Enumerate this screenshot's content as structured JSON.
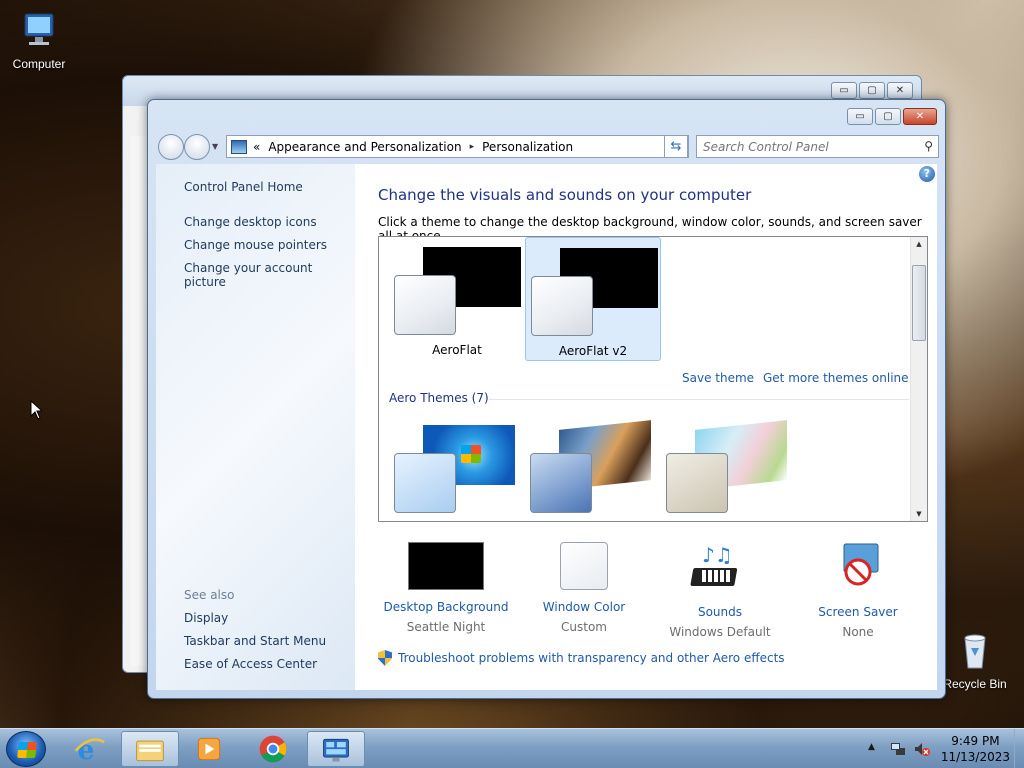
{
  "desktop": {
    "computer_label": "Computer",
    "recycle_label": "Recycle Bin"
  },
  "window": {
    "controls": {
      "minimize": "▭",
      "maximize": "▢",
      "close": "✕"
    },
    "address": {
      "crumbs": [
        "Appearance and Personalization",
        "Personalization"
      ],
      "prefix": "«",
      "separator": "▸"
    },
    "search_placeholder": "Search Control Panel"
  },
  "left_pane": {
    "home": "Control Panel Home",
    "links": [
      "Change desktop icons",
      "Change mouse pointers",
      "Change your account picture"
    ],
    "see_also": "See also",
    "see_also_links": [
      "Display",
      "Taskbar and Start Menu",
      "Ease of Access Center"
    ]
  },
  "main": {
    "heading": "Change the visuals and sounds on your computer",
    "subtext": "Click a theme to change the desktop background, window color, sounds, and screen saver all at once.",
    "my_themes": [
      {
        "name": "AeroFlat",
        "selected": false
      },
      {
        "name": "AeroFlat v2",
        "selected": true
      }
    ],
    "save_theme": "Save theme",
    "get_more": "Get more themes online",
    "aero_group": "Aero Themes (7)",
    "bottom_items": [
      {
        "label": "Desktop Background",
        "value": "Seattle Night",
        "icon": "desktop-background-icon"
      },
      {
        "label": "Window Color",
        "value": "Custom",
        "icon": "window-color-icon"
      },
      {
        "label": "Sounds",
        "value": "Windows Default",
        "icon": "sounds-icon"
      },
      {
        "label": "Screen Saver",
        "value": "None",
        "icon": "screen-saver-icon"
      }
    ],
    "troubleshoot": "Troubleshoot problems with transparency and other Aero effects"
  },
  "taskbar": {
    "time": "9:49 PM",
    "date": "11/13/2023",
    "pinned": [
      "internet-explorer-icon",
      "file-explorer-icon",
      "media-player-icon",
      "chrome-icon",
      "control-panel-icon"
    ]
  },
  "colors": {
    "link": "#1f5aa8",
    "heading": "#1e3287"
  }
}
